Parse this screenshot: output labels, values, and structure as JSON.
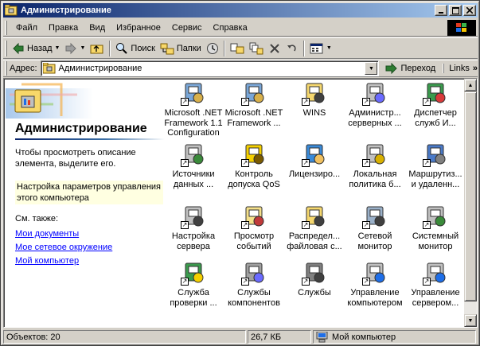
{
  "window": {
    "title": "Администрирование"
  },
  "menu": {
    "items": [
      "Файл",
      "Правка",
      "Вид",
      "Избранное",
      "Сервис",
      "Справка"
    ]
  },
  "toolbar": {
    "back_label": "Назад",
    "search_label": "Поиск",
    "folders_label": "Папки"
  },
  "address": {
    "label": "Адрес:",
    "value": "Администрирование",
    "go_label": "Переход",
    "links_label": "Links"
  },
  "left_pane": {
    "title": "Администрирование",
    "description": "Чтобы просмотреть описание элемента, выделите его.",
    "info": "Настройка параметров управления этого компьютера",
    "see_also": "См. также:",
    "links": [
      "Мои документы",
      "Мое сетевое окружение",
      "Мой компьютер"
    ]
  },
  "icons": [
    {
      "label": "Microsoft .NET Framework 1.1 Configuration",
      "icon": "net-config-icon"
    },
    {
      "label": "Microsoft .NET Framework ...",
      "icon": "net-wizards-icon"
    },
    {
      "label": "WINS",
      "icon": "wins-icon"
    },
    {
      "label": "Администр... серверных ...",
      "icon": "server-admin-icon"
    },
    {
      "label": "Диспетчер служб И...",
      "icon": "iis-manager-icon"
    },
    {
      "label": "Источники данных ...",
      "icon": "odbc-icon"
    },
    {
      "label": "Контроль допуска QoS",
      "icon": "qos-icon"
    },
    {
      "label": "Лицензиро...",
      "icon": "licensing-icon"
    },
    {
      "label": "Локальная политика б...",
      "icon": "security-policy-icon"
    },
    {
      "label": "Маршрутиз... и удаленн...",
      "icon": "routing-icon"
    },
    {
      "label": "Настройка сервера",
      "icon": "server-config-icon"
    },
    {
      "label": "Просмотр событий",
      "icon": "event-viewer-icon"
    },
    {
      "label": "Распредел... файловая с...",
      "icon": "dfs-icon"
    },
    {
      "label": "Сетевой монитор",
      "icon": "network-monitor-icon"
    },
    {
      "label": "Системный монитор",
      "icon": "performance-icon"
    },
    {
      "label": "Служба проверки ...",
      "icon": "ias-icon"
    },
    {
      "label": "Службы компонентов",
      "icon": "component-services-icon"
    },
    {
      "label": "Службы",
      "icon": "services-icon"
    },
    {
      "label": "Управление компьютером",
      "icon": "computer-management-icon"
    },
    {
      "label": "Управление сервером...",
      "icon": "server-management-icon"
    }
  ],
  "status": {
    "objects": "Объектов: 20",
    "size": "26,7 КБ",
    "location": "Мой компьютер"
  },
  "colors": {
    "title_bar": "#0a246a",
    "link": "#0000ff",
    "info_bg": "#ffffe1"
  }
}
